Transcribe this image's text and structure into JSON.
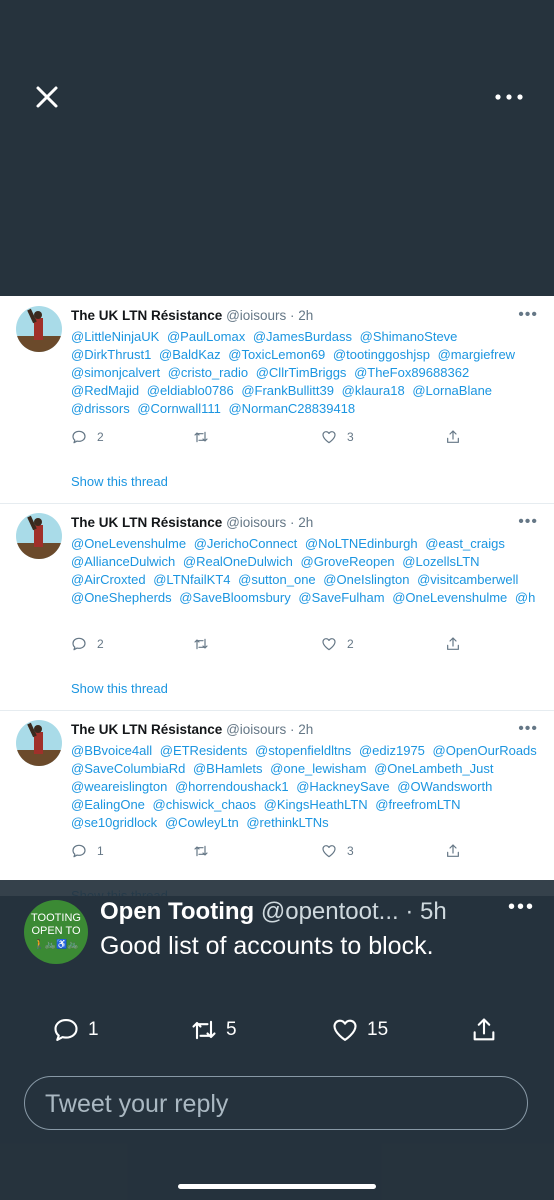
{
  "viewer": {
    "close_icon": "close-icon",
    "more_icon": "more-icon"
  },
  "tweets": [
    {
      "name": "The UK LTN Résistance",
      "meta": "@ioisours · 2h",
      "mentions": [
        "@LittleNinjaUK",
        "@PaulLomax",
        "@JamesBurdass",
        "@ShimanoSteve",
        "@DirkThrust1",
        "@BaldKaz",
        "@ToxicLemon69",
        "@tootinggoshjsp",
        "@margiefrew",
        "@simonjcalvert",
        "@cristo_radio",
        "@CllrTimBriggs",
        "@TheFox89688362",
        "@RedMajid",
        "@eldiablo0786",
        "@FrankBullitt39",
        "@klaura18",
        "@LornaBlane",
        "@drissors",
        "@Cornwall111",
        "@NormanC28839418"
      ],
      "replies": "2",
      "retweets": "",
      "likes": "3",
      "show_thread": "Show this thread"
    },
    {
      "name": "The UK LTN Résistance",
      "meta": "@ioisours · 2h",
      "mentions": [
        "@OneLevenshulme",
        "@JerichoConnect",
        "@NoLTNEdinburgh",
        "@east_craigs",
        "@AllianceDulwich",
        "@RealOneDulwich",
        "@GroveReopen",
        "@LozellsLTN",
        "@AirCroxted",
        "@LTNfailKT4",
        "@sutton_one",
        "@OneIslington",
        "@visitcamberwell",
        "@OneShepherds",
        "@SaveBloomsbury",
        "@SaveFulham",
        "@OneLevenshulme",
        "@h"
      ],
      "replies": "2",
      "retweets": "",
      "likes": "2",
      "show_thread": "Show this thread"
    },
    {
      "name": "The UK LTN Résistance",
      "meta": "@ioisours · 2h",
      "mentions": [
        "@BBvoice4all",
        "@ETResidents",
        "@stopenfieldltns",
        "@ediz1975",
        "@OpenOurRoads",
        "@SaveColumbiaRd",
        "@BHamlets",
        "@one_lewisham",
        "@OneLambeth_Just",
        "@weareislington",
        "@horrendoushack1",
        "@HackneySave",
        "@OWandsworth",
        "@EalingOne",
        "@chiswick_chaos",
        "@KingsHeathLTN",
        "@freefromLTN",
        "@se10gridlock",
        "@CowleyLtn",
        "@rethinkLTNs"
      ],
      "replies": "1",
      "retweets": "",
      "likes": "3",
      "show_thread": "Show this thread"
    }
  ],
  "main_tweet": {
    "avatar_line1": "TOOTING",
    "avatar_line2": "OPEN TO",
    "avatar_line3": "🚶🚲♿🚲",
    "name": "Open Tooting",
    "meta": "@opentoot... · 5h",
    "text": "Good list of accounts to block.",
    "replies": "1",
    "retweets": "5",
    "likes": "15"
  },
  "reply_box": {
    "placeholder": "Tweet your reply"
  },
  "colors": {
    "background": "#26333d",
    "link": "#1b95e0",
    "muted": "#657786"
  }
}
